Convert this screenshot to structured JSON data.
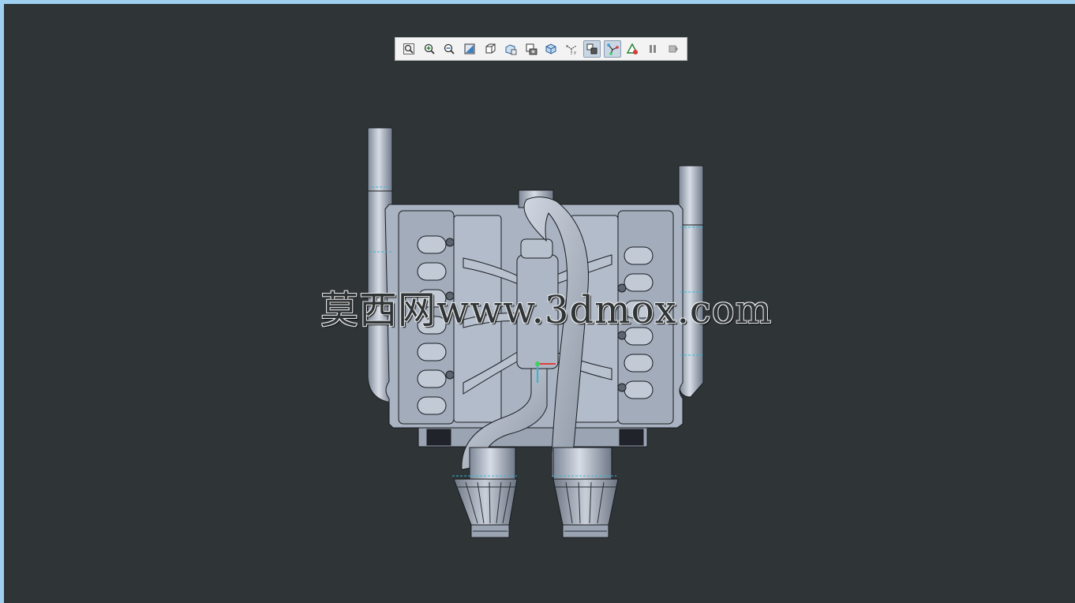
{
  "viewer": {
    "watermark": "莫西网www.3dmox.com"
  },
  "toolbar": {
    "buttons": [
      {
        "name": "refit-icon",
        "active": false
      },
      {
        "name": "zoom-in-icon",
        "active": false
      },
      {
        "name": "zoom-out-icon",
        "active": false
      },
      {
        "name": "repaint-icon",
        "active": false
      },
      {
        "name": "display-style-icon",
        "active": false
      },
      {
        "name": "saved-views-icon",
        "active": false
      },
      {
        "name": "view-manager-icon",
        "active": false
      },
      {
        "name": "perspective-icon",
        "active": false
      },
      {
        "name": "datum-display-icon",
        "active": false
      },
      {
        "name": "spin-center-icon",
        "active": true
      },
      {
        "name": "axis-display-icon",
        "active": true
      },
      {
        "name": "annotation-display-icon",
        "active": false
      },
      {
        "name": "pause-icon",
        "active": false
      },
      {
        "name": "next-icon",
        "active": false
      }
    ]
  },
  "colors": {
    "background": "#2f3436",
    "frame": "#9fd0ef",
    "model": "#a9b3c2",
    "edge": "#1a1d22",
    "datum": "#2fb6d8"
  }
}
